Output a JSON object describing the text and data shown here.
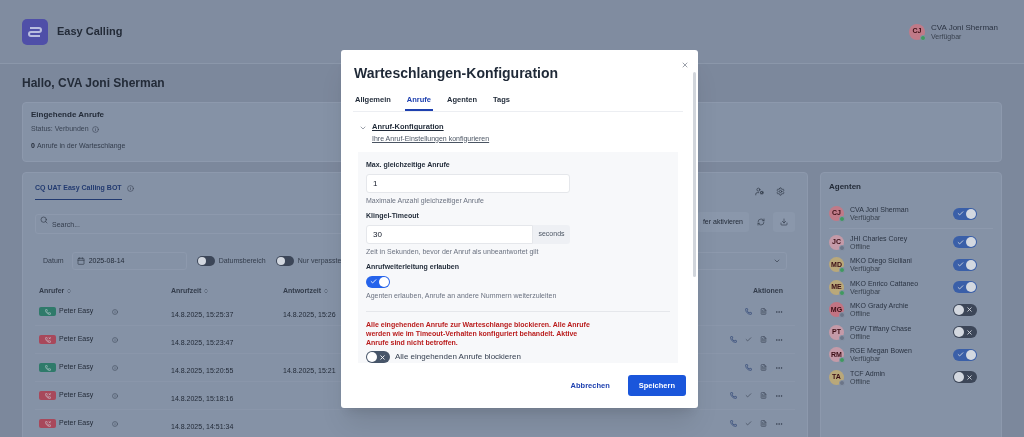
{
  "app": {
    "name": "Easy Calling"
  },
  "user": {
    "initials": "CJ",
    "name": "CVA Joni Sherman",
    "status": "Verfügbar",
    "available": true,
    "color": "#c07a88"
  },
  "greeting": "Hallo, CVA Joni Sherman",
  "incoming": {
    "title": "Eingehende Anrufe",
    "status": "Status: Verbunden",
    "count": "0",
    "count_label": "Anrufe in der Warteschlange"
  },
  "queue": {
    "tabs": [
      {
        "label": "CQ UAT Easy Calling BOT",
        "selected": true
      }
    ],
    "search": {
      "placeholder": "Search..."
    },
    "action_button": "fer aktivieren",
    "date_label": "Datum",
    "date_value": "2025-08-14",
    "toggles": [
      {
        "label": "Datumsbereich",
        "on": false
      },
      {
        "label": "Nur verpasste",
        "on": false
      }
    ],
    "columns": [
      "Anrufer",
      "Anrufzeit",
      "Antwortzeit"
    ],
    "actions_column": "Aktionen",
    "rows": [
      {
        "missed": false,
        "caller": "Peter Easy",
        "call_time": "14.8.2025, 15:25:37",
        "answer_time": "14.8.2025, 15:26"
      },
      {
        "missed": true,
        "caller": "Peter Easy",
        "call_time": "14.8.2025, 15:23:47"
      },
      {
        "missed": false,
        "caller": "Peter Easy",
        "call_time": "14.8.2025, 15:20:55",
        "answer_time": "14.8.2025, 15:21"
      },
      {
        "missed": true,
        "caller": "Peter Easy",
        "call_time": "14.8.2025, 15:18:16"
      },
      {
        "missed": true,
        "caller": "Peter Easy",
        "call_time": "14.8.2025, 14:51:34"
      }
    ]
  },
  "agents_panel": {
    "title": "Agenten",
    "agents": [
      {
        "initials": "CJ",
        "name": "CVA Joni Sherman",
        "status": "Verfügbar",
        "available": true,
        "enabled": true,
        "color": "#c07a88"
      },
      {
        "initials": "JC",
        "name": "JHI Charles Corey",
        "status": "Offline",
        "available": false,
        "enabled": true,
        "color": "#c49aa8"
      },
      {
        "initials": "MD",
        "name": "MKO Diego Siciliani",
        "status": "Verfügbar",
        "available": true,
        "enabled": true,
        "color": "#b9a87a"
      },
      {
        "initials": "ME",
        "name": "MKO Enrico Cattaneo",
        "status": "Verfügbar",
        "available": true,
        "enabled": true,
        "color": "#b9a87a"
      },
      {
        "initials": "MG",
        "name": "MKO Grady Archie",
        "status": "Offline",
        "available": false,
        "enabled": false,
        "color": "#c27483"
      },
      {
        "initials": "PT",
        "name": "PGW Tiffany Chase",
        "status": "Offline",
        "available": false,
        "enabled": false,
        "color": "#c49aa8"
      },
      {
        "initials": "RM",
        "name": "RGE Megan Bowen",
        "status": "Verfügbar",
        "available": true,
        "enabled": true,
        "color": "#c49aa8"
      },
      {
        "initials": "TA",
        "name": "TCF Admin",
        "status": "Offline",
        "available": false,
        "enabled": false,
        "color": "#b9a87a"
      }
    ]
  },
  "dialog": {
    "title": "Warteschlangen-Konfiguration",
    "tabs": [
      {
        "label": "Allgemein",
        "selected": false
      },
      {
        "label": "Anrufe",
        "selected": true
      },
      {
        "label": "Agenten",
        "selected": false
      },
      {
        "label": "Tags",
        "selected": false
      }
    ],
    "section": {
      "title": "Anruf-Konfiguration",
      "subtitle": "Ihre Anruf-Einstellungen konfigurieren",
      "expanded": true
    },
    "fields": [
      {
        "kind": "input",
        "label": "Max. gleichzeitige Anrufe",
        "value": "1",
        "hint": "Maximale Anzahl gleichzeitiger Anrufe"
      },
      {
        "kind": "input",
        "label": "Klingel-Timeout",
        "value": "30",
        "unit": "seconds",
        "hint": "Zeit in Sekunden, bevor der Anruf als unbeantwortet gilt"
      },
      {
        "kind": "switch",
        "label": "Anrufweiterleitung erlauben",
        "on": true,
        "hint": "Agenten erlauben, Anrufe an andere Nummern weiterzuleiten"
      },
      {
        "kind": "warning_switch",
        "warning": "Alle eingehenden Anrufe zur Warteschlange blockieren. Alle Anrufe werden wie im Timeout-Verhalten konfiguriert behandelt. Aktive Anrufe sind nicht betroffen.",
        "label": "Alle eingehenden Anrufe blockieren",
        "on": false
      }
    ],
    "buttons": [
      {
        "label": "Abbrechen",
        "kind": "secondary"
      },
      {
        "label": "Speichern",
        "kind": "primary"
      }
    ]
  }
}
